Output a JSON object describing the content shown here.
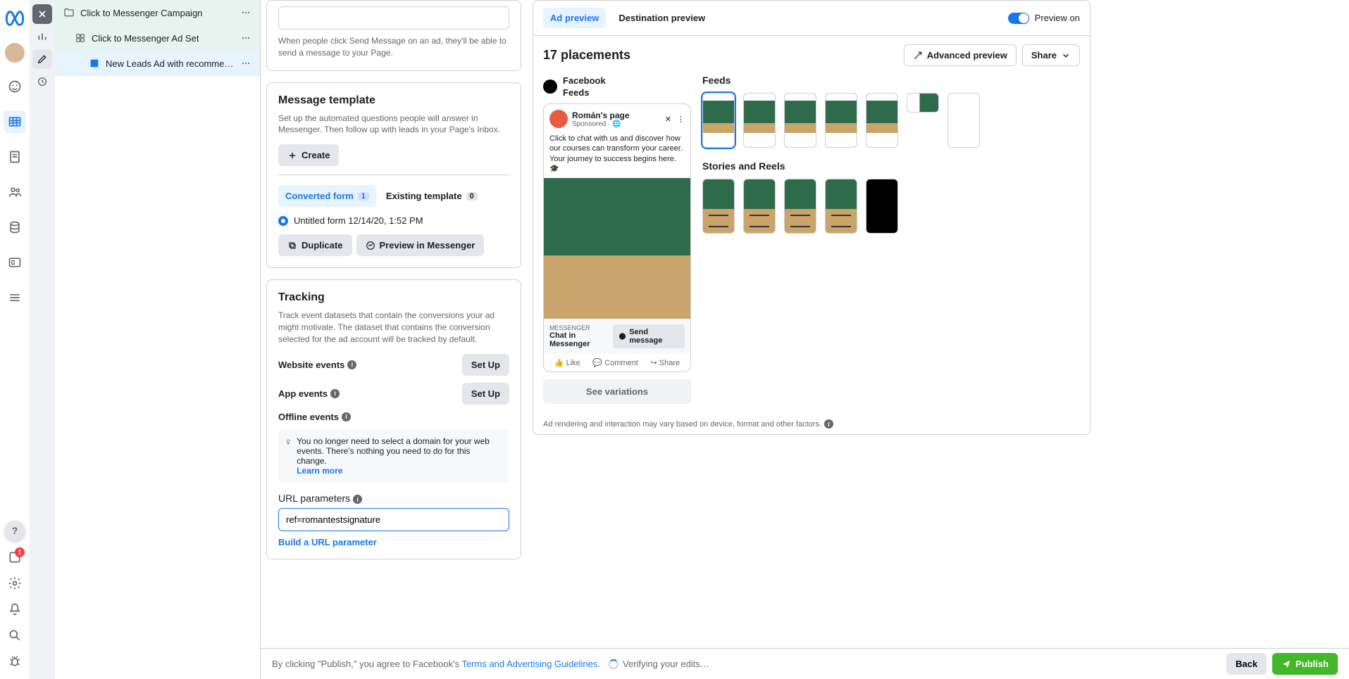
{
  "tree": {
    "campaign": "Click to Messenger Campaign",
    "adset": "Click to Messenger Ad Set",
    "ad": "New Leads Ad with recommend…"
  },
  "topcard": {
    "select": "",
    "desc": "When people click Send Message on an ad, they'll be able to send a message to your Page."
  },
  "template": {
    "title": "Message template",
    "desc": "Set up the automated questions people will answer in Messenger. Then follow up with leads in your Page's Inbox.",
    "create": "Create",
    "tabs": {
      "converted": "Converted form",
      "converted_count": "1",
      "existing": "Existing template",
      "existing_count": "0"
    },
    "form_name": "Untitled form 12/14/20, 1:52 PM",
    "duplicate": "Duplicate",
    "preview": "Preview in Messenger"
  },
  "tracking": {
    "title": "Tracking",
    "desc": "Track event datasets that contain the conversions your ad might motivate. The dataset that contains the conversion selected for the ad account will be tracked by default.",
    "website": "Website events",
    "app": "App events",
    "offline": "Offline events",
    "setup": "Set Up",
    "tip": "You no longer need to select a domain for your web events. There's nothing you need to do for this change.",
    "learn": "Learn more",
    "url_label": "URL parameters",
    "url_value": "ref=romantestsignature",
    "build": "Build a URL parameter"
  },
  "preview": {
    "tabs": {
      "ad": "Ad preview",
      "dest": "Destination preview"
    },
    "toggle": "Preview on",
    "placements": "17 placements",
    "advanced": "Advanced preview",
    "share": "Share",
    "feed_label_top": "Facebook",
    "feed_label_bottom": "Feeds",
    "ad": {
      "page": "Román's page",
      "sponsored": "Sponsored",
      "text": "Click to chat with us and discover how our courses can transform your career. Your journey to success begins here. 🎓",
      "cta_sub": "MESSENGER",
      "cta_title": "Chat in Messenger",
      "cta_btn": "Send message",
      "like": "Like",
      "comment": "Comment",
      "share_txt": "Share"
    },
    "see_variations": "See variations",
    "feeds_title": "Feeds",
    "stories_title": "Stories and Reels",
    "footer": "Ad rendering and interaction may vary based on device, format and other factors."
  },
  "bar": {
    "agree_pre": "By clicking \"Publish,\" you agree to Facebook's ",
    "agree_link": "Terms and Advertising Guidelines",
    "verify": "Verifying your edits…",
    "back": "Back",
    "publish": "Publish",
    "badge": "1"
  }
}
